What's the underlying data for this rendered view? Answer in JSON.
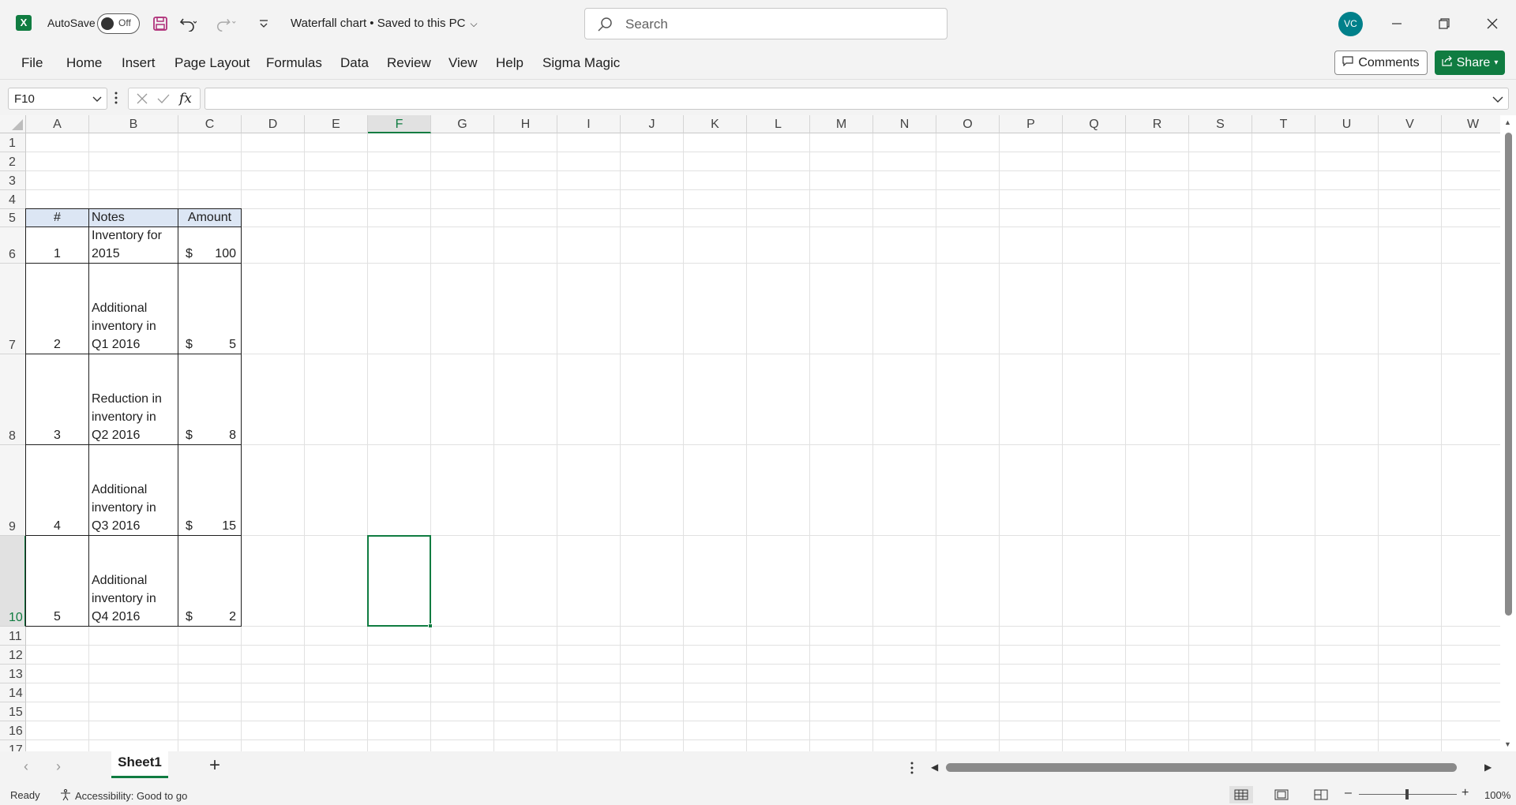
{
  "titlebar": {
    "app_logo": "X",
    "autosave_label": "AutoSave",
    "autosave_state": "Off",
    "doc_title": "Waterfall chart • Saved to this PC",
    "search_placeholder": "Search",
    "user_initials": "VC"
  },
  "ribbon": {
    "tabs": [
      "File",
      "Home",
      "Insert",
      "Page Layout",
      "Formulas",
      "Data",
      "Review",
      "View",
      "Help",
      "Sigma Magic"
    ],
    "comments_label": "Comments",
    "share_label": "Share"
  },
  "formula_bar": {
    "name_box": "F10",
    "fx_label": "fx",
    "formula": ""
  },
  "grid": {
    "columns": [
      "A",
      "B",
      "C",
      "D",
      "E",
      "F",
      "G",
      "H",
      "I",
      "J",
      "K",
      "L",
      "M",
      "N",
      "O",
      "P",
      "Q",
      "R",
      "S",
      "T",
      "U",
      "V",
      "W"
    ],
    "rows": [
      "1",
      "2",
      "3",
      "4",
      "5",
      "6",
      "7",
      "8",
      "9",
      "10",
      "11",
      "12",
      "13",
      "14",
      "15",
      "16",
      "17"
    ],
    "selected_cell": "F10",
    "table": {
      "headers": [
        "#",
        "Notes",
        "Amount"
      ],
      "rows": [
        {
          "num": "1",
          "notes": [
            "Inventory for",
            "2015"
          ],
          "currency": "$",
          "amount": "100"
        },
        {
          "num": "2",
          "notes": [
            "Additional",
            "inventory in",
            "Q1 2016"
          ],
          "currency": "$",
          "amount": "5"
        },
        {
          "num": "3",
          "notes": [
            "Reduction in",
            "inventory in",
            "Q2 2016"
          ],
          "currency": "$",
          "amount": "8"
        },
        {
          "num": "4",
          "notes": [
            "Additional",
            "inventory in",
            "Q3 2016"
          ],
          "currency": "$",
          "amount": "15"
        },
        {
          "num": "5",
          "notes": [
            "Additional",
            "inventory in",
            "Q4 2016"
          ],
          "currency": "$",
          "amount": "2"
        }
      ]
    }
  },
  "sheets": {
    "tabs": [
      "Sheet1"
    ],
    "active": "Sheet1",
    "add_label": "+"
  },
  "status": {
    "ready": "Ready",
    "accessibility": "Accessibility: Good to go",
    "zoom": "100%"
  },
  "colors": {
    "accent": "#107c41",
    "header_fill": "#dce6f4",
    "avatar": "#00808a"
  }
}
